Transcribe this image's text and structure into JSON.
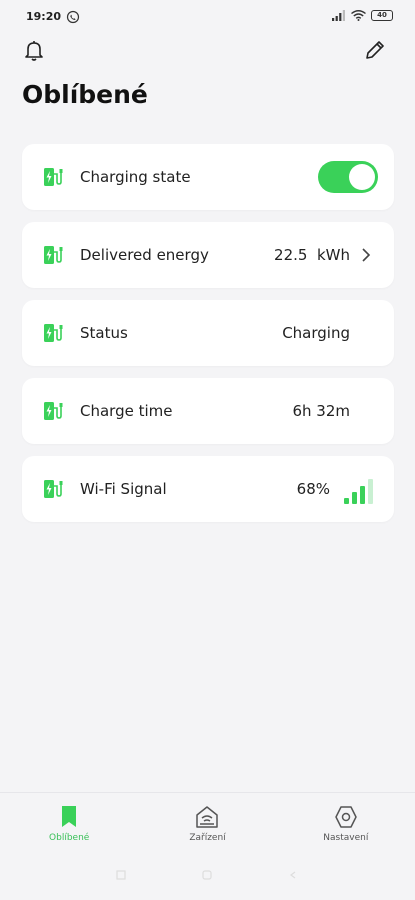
{
  "status_bar": {
    "time": "19:20",
    "battery": "40"
  },
  "page": {
    "title": "Oblíbené"
  },
  "cards": [
    {
      "label": "Charging state",
      "toggle_on": true
    },
    {
      "label": "Delivered energy",
      "value": "22.5  kWh"
    },
    {
      "label": "Status",
      "value": "Charging"
    },
    {
      "label": "Charge time",
      "value": "6h 32m"
    },
    {
      "label": "Wi-Fi Signal",
      "value": "68%",
      "signal_level": 0.68
    }
  ],
  "tabs": [
    {
      "label": "Oblíbené",
      "icon": "bookmark-icon",
      "active": true
    },
    {
      "label": "Zařízení",
      "icon": "device-icon",
      "active": false
    },
    {
      "label": "Nastavení",
      "icon": "settings-icon",
      "active": false
    }
  ],
  "colors": {
    "accent": "#3ad159",
    "background": "#f4f4f6",
    "card": "#ffffff"
  }
}
